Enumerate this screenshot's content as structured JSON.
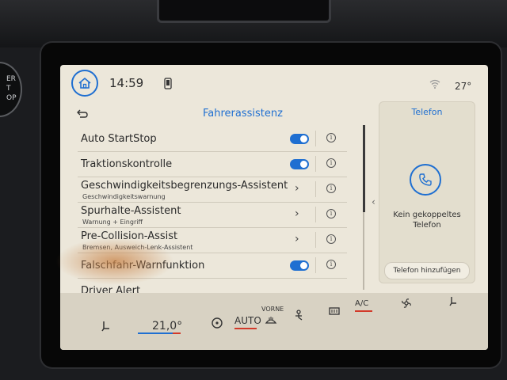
{
  "status": {
    "time": "14:59",
    "temperature": "27°"
  },
  "panel": {
    "title": "Fahrerassistenz",
    "items": [
      {
        "label": "Auto StartStop",
        "sub": "",
        "control": "toggle",
        "on": true
      },
      {
        "label": "Traktionskontrolle",
        "sub": "",
        "control": "toggle",
        "on": true
      },
      {
        "label": "Geschwindigkeitsbegrenzungs-Assistent",
        "sub": "Geschwindigkeitswarnung",
        "control": "chevron"
      },
      {
        "label": "Spurhalte-Assistent",
        "sub": "Warnung + Eingriff",
        "control": "chevron"
      },
      {
        "label": "Pre-Collision-Assist",
        "sub": "Bremsen, Ausweich-Lenk-Assistent",
        "control": "chevron"
      },
      {
        "label": "Falschfahr-Warnfunktion",
        "sub": "",
        "control": "toggle",
        "on": true
      },
      {
        "label": "Driver Alert",
        "sub": "",
        "control": "none"
      }
    ]
  },
  "phone_card": {
    "title": "Telefon",
    "message_line1": "Kein gekoppeltes",
    "message_line2": "Telefon",
    "add_button": "Telefon hinzufügen"
  },
  "climate": {
    "temp_left": "21,0°",
    "auto_label": "AUTO",
    "front_label": "VORNE",
    "ac_label": "A/C"
  },
  "knob_text": [
    "ER",
    "T",
    "OP"
  ],
  "colors": {
    "accent": "#1f6fd1",
    "background": "#ece7da"
  }
}
